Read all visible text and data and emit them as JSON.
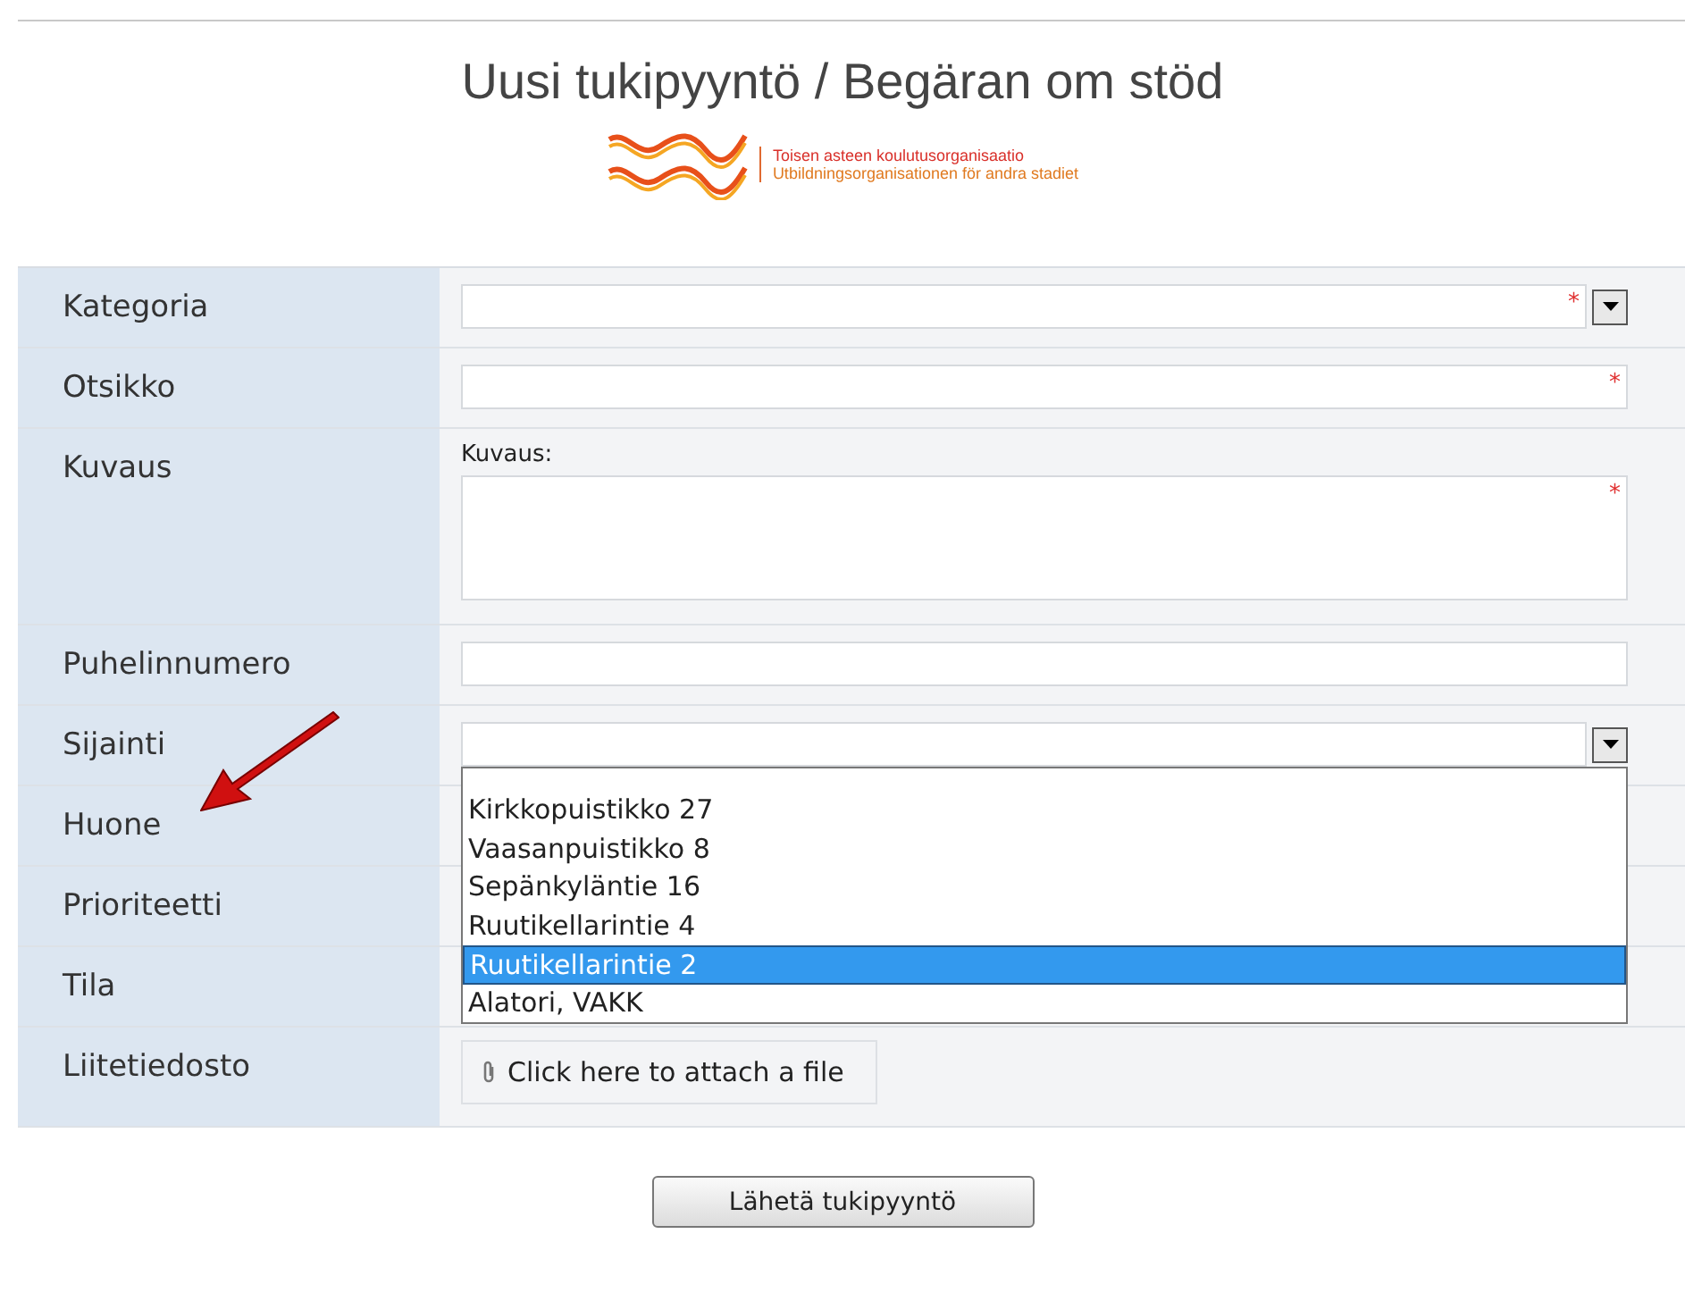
{
  "title": "Uusi tukipyyntö / Begäran om stöd",
  "logo": {
    "line_1": "Toisen asteen koulutusorganisaatio",
    "line_2": "Utbildningsorganisationen för andra stadiet"
  },
  "rows": [
    {
      "label": "Kategoria",
      "kind": "select",
      "required": "*"
    },
    {
      "label": "Otsikko",
      "kind": "text",
      "required": "*"
    },
    {
      "label": "Kuvaus",
      "kind": "textarea",
      "caption": "Kuvaus:",
      "required": "*"
    },
    {
      "label": "Puhelinnumero",
      "kind": "text"
    },
    {
      "label": "Sijainti",
      "kind": "select",
      "open": true,
      "options": [
        {
          "label": "Kirkkopuistikko 27",
          "selected": false
        },
        {
          "label": "Vaasanpuistikko 8",
          "selected": false
        },
        {
          "label": "Sepänkyläntie 16",
          "selected": false
        },
        {
          "label": "Ruutikellarintie 4",
          "selected": false
        },
        {
          "label": "Ruutikellarintie 2",
          "selected": true
        },
        {
          "label": "Alatori, VAKK",
          "selected": false
        }
      ]
    },
    {
      "label": "Huone",
      "kind": "covered",
      "pointer": true
    },
    {
      "label": "Prioriteetti",
      "kind": "covered"
    },
    {
      "label": "Tila",
      "kind": "covered"
    },
    {
      "label": "Liitetiedosto",
      "kind": "file",
      "link": "Click here to attach a file"
    }
  ],
  "submit": "Lähetä tukipyyntö"
}
